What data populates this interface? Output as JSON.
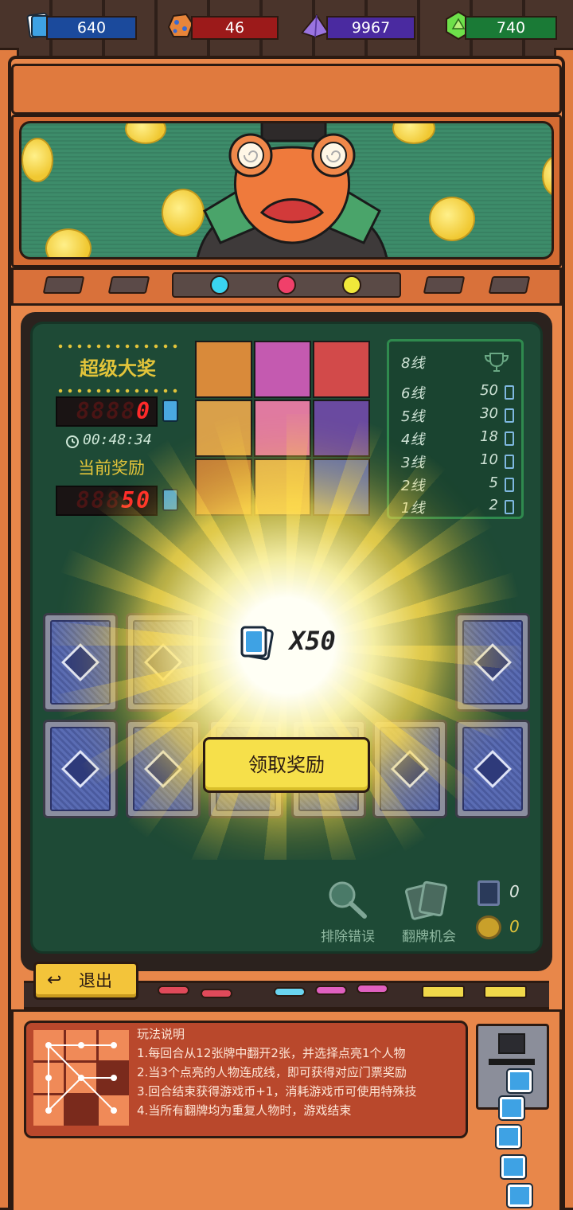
{
  "currencies": [
    {
      "name": "tickets",
      "value": "640",
      "color": "#1b4a9c",
      "icon": "ticket-icon"
    },
    {
      "name": "ore",
      "value": "46",
      "color": "#9c1a1a",
      "icon": "ore-icon"
    },
    {
      "name": "purple-crystal",
      "value": "9967",
      "color": "#4a2aa0",
      "icon": "crystal-icon"
    },
    {
      "name": "green-gem",
      "value": "740",
      "color": "#1a7a36",
      "icon": "gem-icon"
    }
  ],
  "jackpot": {
    "title": "超级大奖",
    "value_ghost": "8888",
    "value": "0",
    "timer": "00:48:34"
  },
  "current_reward": {
    "label": "当前奖励",
    "value_ghost": "888",
    "value": "50"
  },
  "paytable": {
    "rows": [
      {
        "lines": "8线",
        "reward": ""
      },
      {
        "lines": "6线",
        "reward": "50"
      },
      {
        "lines": "5线",
        "reward": "30"
      },
      {
        "lines": "4线",
        "reward": "18"
      },
      {
        "lines": "3线",
        "reward": "10"
      },
      {
        "lines": "2线",
        "reward": "5"
      },
      {
        "lines": "1线",
        "reward": "2"
      }
    ],
    "top_icon": "trophy-icon"
  },
  "reward_popup": {
    "amount": "X50",
    "icon": "ticket-icon",
    "claim_label": "领取奖励"
  },
  "tools": {
    "remove_error_label": "排除错误",
    "flip_chance_label": "翻牌机会",
    "ticket_count": "0",
    "coin_count": "0"
  },
  "exit_label": "退出",
  "rules": {
    "title": "玩法说明",
    "items": [
      "1.每回合从12张牌中翻开2张，并选择点亮1个人物",
      "2.当3个点亮的人物连成线，即可获得对应门票奖励",
      "3.回合结束获得游戏币+1，消耗游戏币可使用特殊技",
      "4.当所有翻牌均为重复人物时，游戏结束"
    ]
  },
  "colors": {
    "cabinet": "#e8874a",
    "board": "#1e4a36",
    "accent_yellow": "#f6e04a",
    "led_red": "#ff2a2a"
  }
}
